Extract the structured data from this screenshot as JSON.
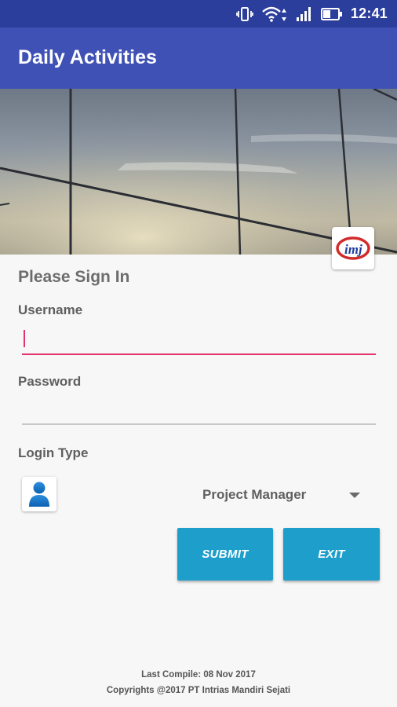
{
  "statusbar": {
    "time": "12:41",
    "icons": [
      "vibrate-icon",
      "wifi-icon",
      "signal-icon",
      "battery-icon"
    ]
  },
  "appbar": {
    "title": "Daily Activities"
  },
  "header": {
    "logo": "imj-logo"
  },
  "form": {
    "heading": "Please Sign In",
    "username_label": "Username",
    "username_value": "",
    "password_label": "Password",
    "password_value": "",
    "login_type_label": "Login Type",
    "login_type_selected": "Project Manager",
    "submit_label": "SUBMIT",
    "exit_label": "EXIT"
  },
  "footer": {
    "compile": "Last Compile: 08 Nov 2017",
    "copyright": "Copyrights @2017 PT Intrias Mandiri Sejati"
  },
  "colors": {
    "statusbar": "#2c3e9c",
    "appbar": "#3f51b5",
    "accent": "#e2336b",
    "button": "#1e9ecb"
  }
}
